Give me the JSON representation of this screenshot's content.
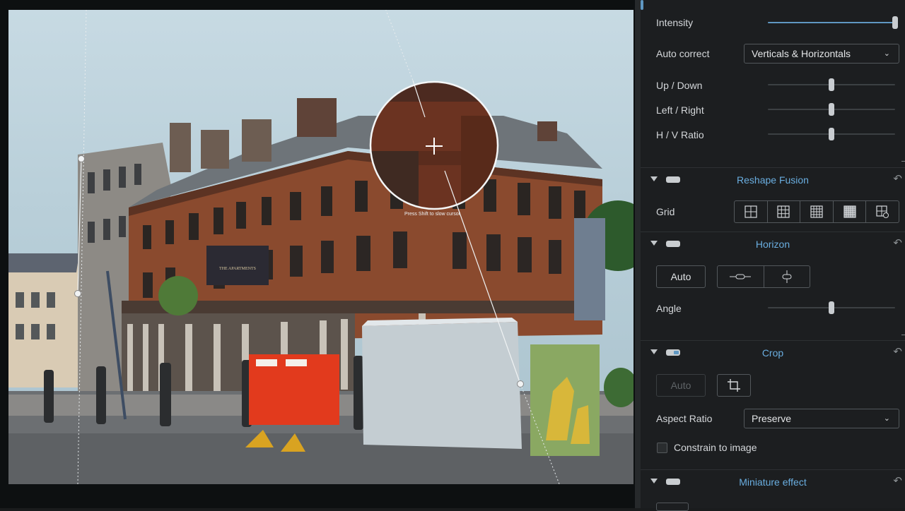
{
  "photo": {
    "loupe_hint": "Press Shift to slow cursor",
    "sign_text": "THE APARTMENTS"
  },
  "panel": {
    "intensity": {
      "label": "Intensity",
      "value": 1.0
    },
    "auto_correct": {
      "label": "Auto correct",
      "value": "Verticals & Horizontals"
    },
    "up_down": {
      "label": "Up / Down",
      "value": 0.5
    },
    "left_right": {
      "label": "Left / Right",
      "value": 0.5
    },
    "hv_ratio": {
      "label": "H / V Ratio",
      "value": 0.5
    },
    "reshape_fusion": {
      "title": "Reshape Fusion",
      "grid_label": "Grid",
      "grid_icons": [
        "grid-2x2-icon",
        "grid-3x3-icon",
        "grid-4x4-icon",
        "grid-dense-icon",
        "grid-custom-icon"
      ]
    },
    "horizon": {
      "title": "Horizon",
      "auto_label": "Auto",
      "angle_label": "Angle",
      "angle_value": 0.5
    },
    "crop": {
      "title": "Crop",
      "auto_label": "Auto",
      "aspect_label": "Aspect Ratio",
      "aspect_value": "Preserve",
      "constrain_label": "Constrain to image"
    },
    "miniature": {
      "title": "Miniature effect"
    },
    "accent_color": "#6aaee0"
  }
}
